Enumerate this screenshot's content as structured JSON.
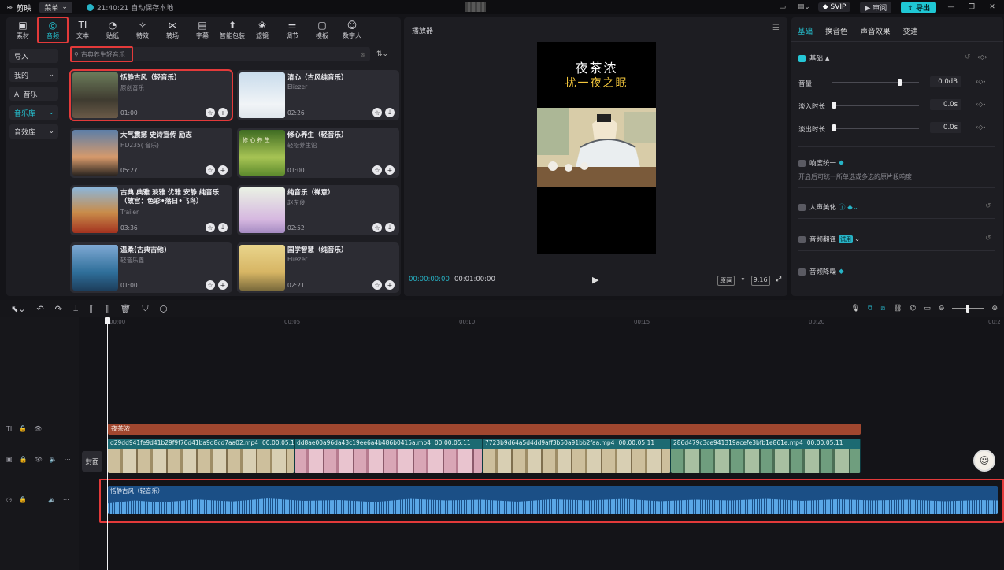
{
  "titlebar": {
    "app_name": "剪映",
    "menu_label": "菜单",
    "autosave_text": "21:40:21 自动保存本地",
    "svip_label": "SVIP",
    "review_label": "审阅",
    "export_label": "导出"
  },
  "media_tabs": [
    {
      "label": "素材",
      "icon": "media-icon",
      "glyph": "▣"
    },
    {
      "label": "音频",
      "icon": "audio-icon",
      "glyph": "◎"
    },
    {
      "label": "文本",
      "icon": "text-icon",
      "glyph": "TI"
    },
    {
      "label": "贴纸",
      "icon": "sticker-icon",
      "glyph": "◔"
    },
    {
      "label": "特效",
      "icon": "effects-icon",
      "glyph": "✧"
    },
    {
      "label": "转场",
      "icon": "transition-icon",
      "glyph": "⋈"
    },
    {
      "label": "字幕",
      "icon": "subtitle-icon",
      "glyph": "▤"
    },
    {
      "label": "智能包装",
      "icon": "smart-package-icon",
      "glyph": "⬆"
    },
    {
      "label": "滤镜",
      "icon": "filter-icon",
      "glyph": "❀"
    },
    {
      "label": "调节",
      "icon": "adjust-icon",
      "glyph": "⚌"
    },
    {
      "label": "模板",
      "icon": "template-icon",
      "glyph": "▢"
    },
    {
      "label": "数字人",
      "icon": "digital-human-icon",
      "glyph": "☺"
    }
  ],
  "media_side": [
    {
      "label": "导入",
      "caret": ""
    },
    {
      "label": "我的",
      "caret": "⌄"
    },
    {
      "label": "AI 音乐",
      "caret": ""
    },
    {
      "label": "音乐库",
      "caret": "⌄"
    },
    {
      "label": "音效库",
      "caret": "⌄"
    }
  ],
  "search": {
    "placeholder": "古典养生轻音乐"
  },
  "music_cards": [
    {
      "title": "恬静古风（轻音乐）",
      "artist": "原创音乐",
      "duration": "01:00",
      "action": "+"
    },
    {
      "title": "清心（古风纯音乐）",
      "artist": "Eliezer",
      "duration": "02:26",
      "action": "⤓"
    },
    {
      "title": "大气震撼 史诗宣传 励志",
      "artist": "HD235( 音乐)",
      "duration": "05:27",
      "action": "+"
    },
    {
      "title": "修心养生（轻音乐）",
      "artist": "轻松养生馆",
      "duration": "01:00",
      "action": "+"
    },
    {
      "title": "古典 典雅 淡雅 优雅 安静 纯音乐（故宫：色彩•落日•飞鸟）",
      "artist": "Trailer",
      "duration": "03:36",
      "action": "⤓"
    },
    {
      "title": "纯音乐（禅意）",
      "artist": "赵东俊",
      "duration": "02:52",
      "action": "⤓"
    },
    {
      "title": "温柔(古典吉他)",
      "artist": "轻音乐鑫",
      "duration": "01:00",
      "action": "+"
    },
    {
      "title": "国学智慧（纯音乐）",
      "artist": "Eliezer",
      "duration": "02:21",
      "action": "+"
    }
  ],
  "thumb_label_4": "修 心 养 生",
  "player": {
    "title": "播放器",
    "video_title_1": "夜茶浓",
    "video_title_2": "扰一夜之眠",
    "time_current": "00:00:00:00",
    "time_total": "00:01:00:00",
    "ctrl_original": "原画",
    "ctrl_ratio": "9:16"
  },
  "inspector": {
    "tabs": [
      "基础",
      "换音色",
      "声音效果",
      "变速"
    ],
    "section": "基础",
    "volume_label": "音量",
    "volume_value": "0.0dB",
    "volume_level": 0.75,
    "fade_in_label": "淡入时长",
    "fade_in_value": "0.0s",
    "fade_out_label": "淡出时长",
    "fade_out_value": "0.0s",
    "loudness_label": "响度统一",
    "loudness_hint": "开启后可统一所单选或多选的原片段响度",
    "voice_beauty_label": "人声美化",
    "translate_label": "音频翻译",
    "translate_badge": "试用",
    "denoise_label": "音频降噪"
  },
  "timeline": {
    "ruler": [
      "00:00",
      "00:05",
      "00:10",
      "00:15",
      "00:20"
    ],
    "ruler_last": "00:2",
    "text_clip": "夜茶浓",
    "cover_label": "封面",
    "video_clips": [
      {
        "name": "d29dd941fe9d41b29f9f76d41ba9d8cd7aa02.mp4",
        "duration": "00:00:05:11",
        "style": ""
      },
      {
        "name": "dd8ae00a96da43c19ee6a4b486b0415a.mp4",
        "duration": "00:00:05:11",
        "style": "pink"
      },
      {
        "name": "7723b9d64a5d4dd9aff3b50a91bb2faa.mp4",
        "duration": "00:00:05:11",
        "style": ""
      },
      {
        "name": "286d479c3ce941319acefe3bfb1e861e.mp4",
        "duration": "00:00:05:11",
        "style": "green"
      }
    ],
    "audio_clip": "恬静古风（轻音乐）"
  },
  "colors": {
    "accent": "#25c7d6",
    "highlight": "#e33a3a",
    "text_clip": "#a0472f",
    "audio_clip": "#1b4f86"
  }
}
